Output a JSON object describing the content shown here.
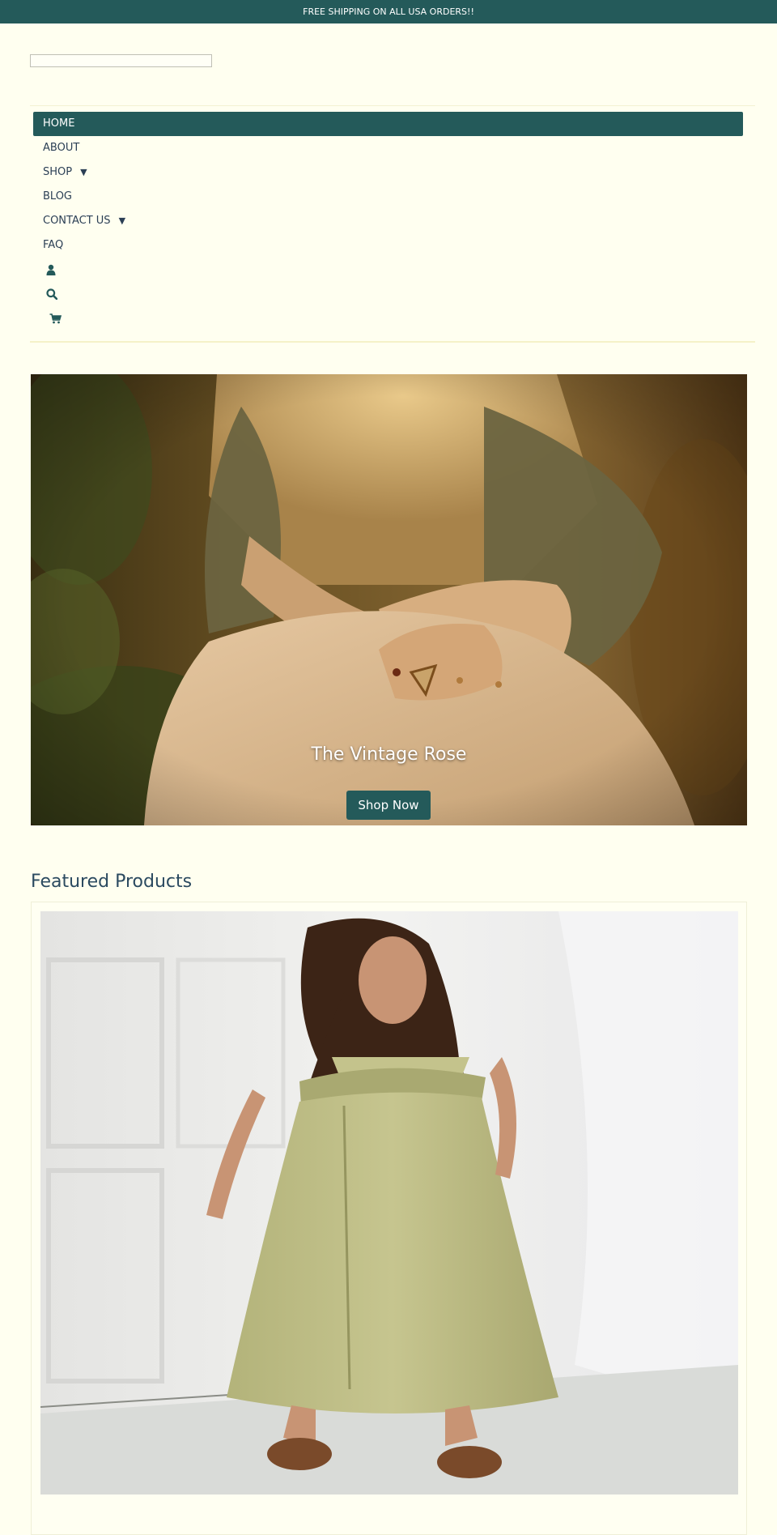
{
  "announcement": "FREE SHIPPING ON ALL USA ORDERS!!",
  "nav": {
    "home": "HOME",
    "about": "ABOUT",
    "shop": "SHOP",
    "blog": "BLOG",
    "contact": "CONTACT US",
    "faq": "FAQ",
    "caret": "▼",
    "account_icon": "user-icon",
    "search_icon": "search-icon",
    "cart_icon": "cart-icon"
  },
  "hero": {
    "title": "The Vintage Rose",
    "button": "Shop Now"
  },
  "featured": {
    "title": "Featured Products"
  },
  "colors": {
    "accent": "#245a5a",
    "background": "#fffff0",
    "text": "#2b3f55"
  }
}
